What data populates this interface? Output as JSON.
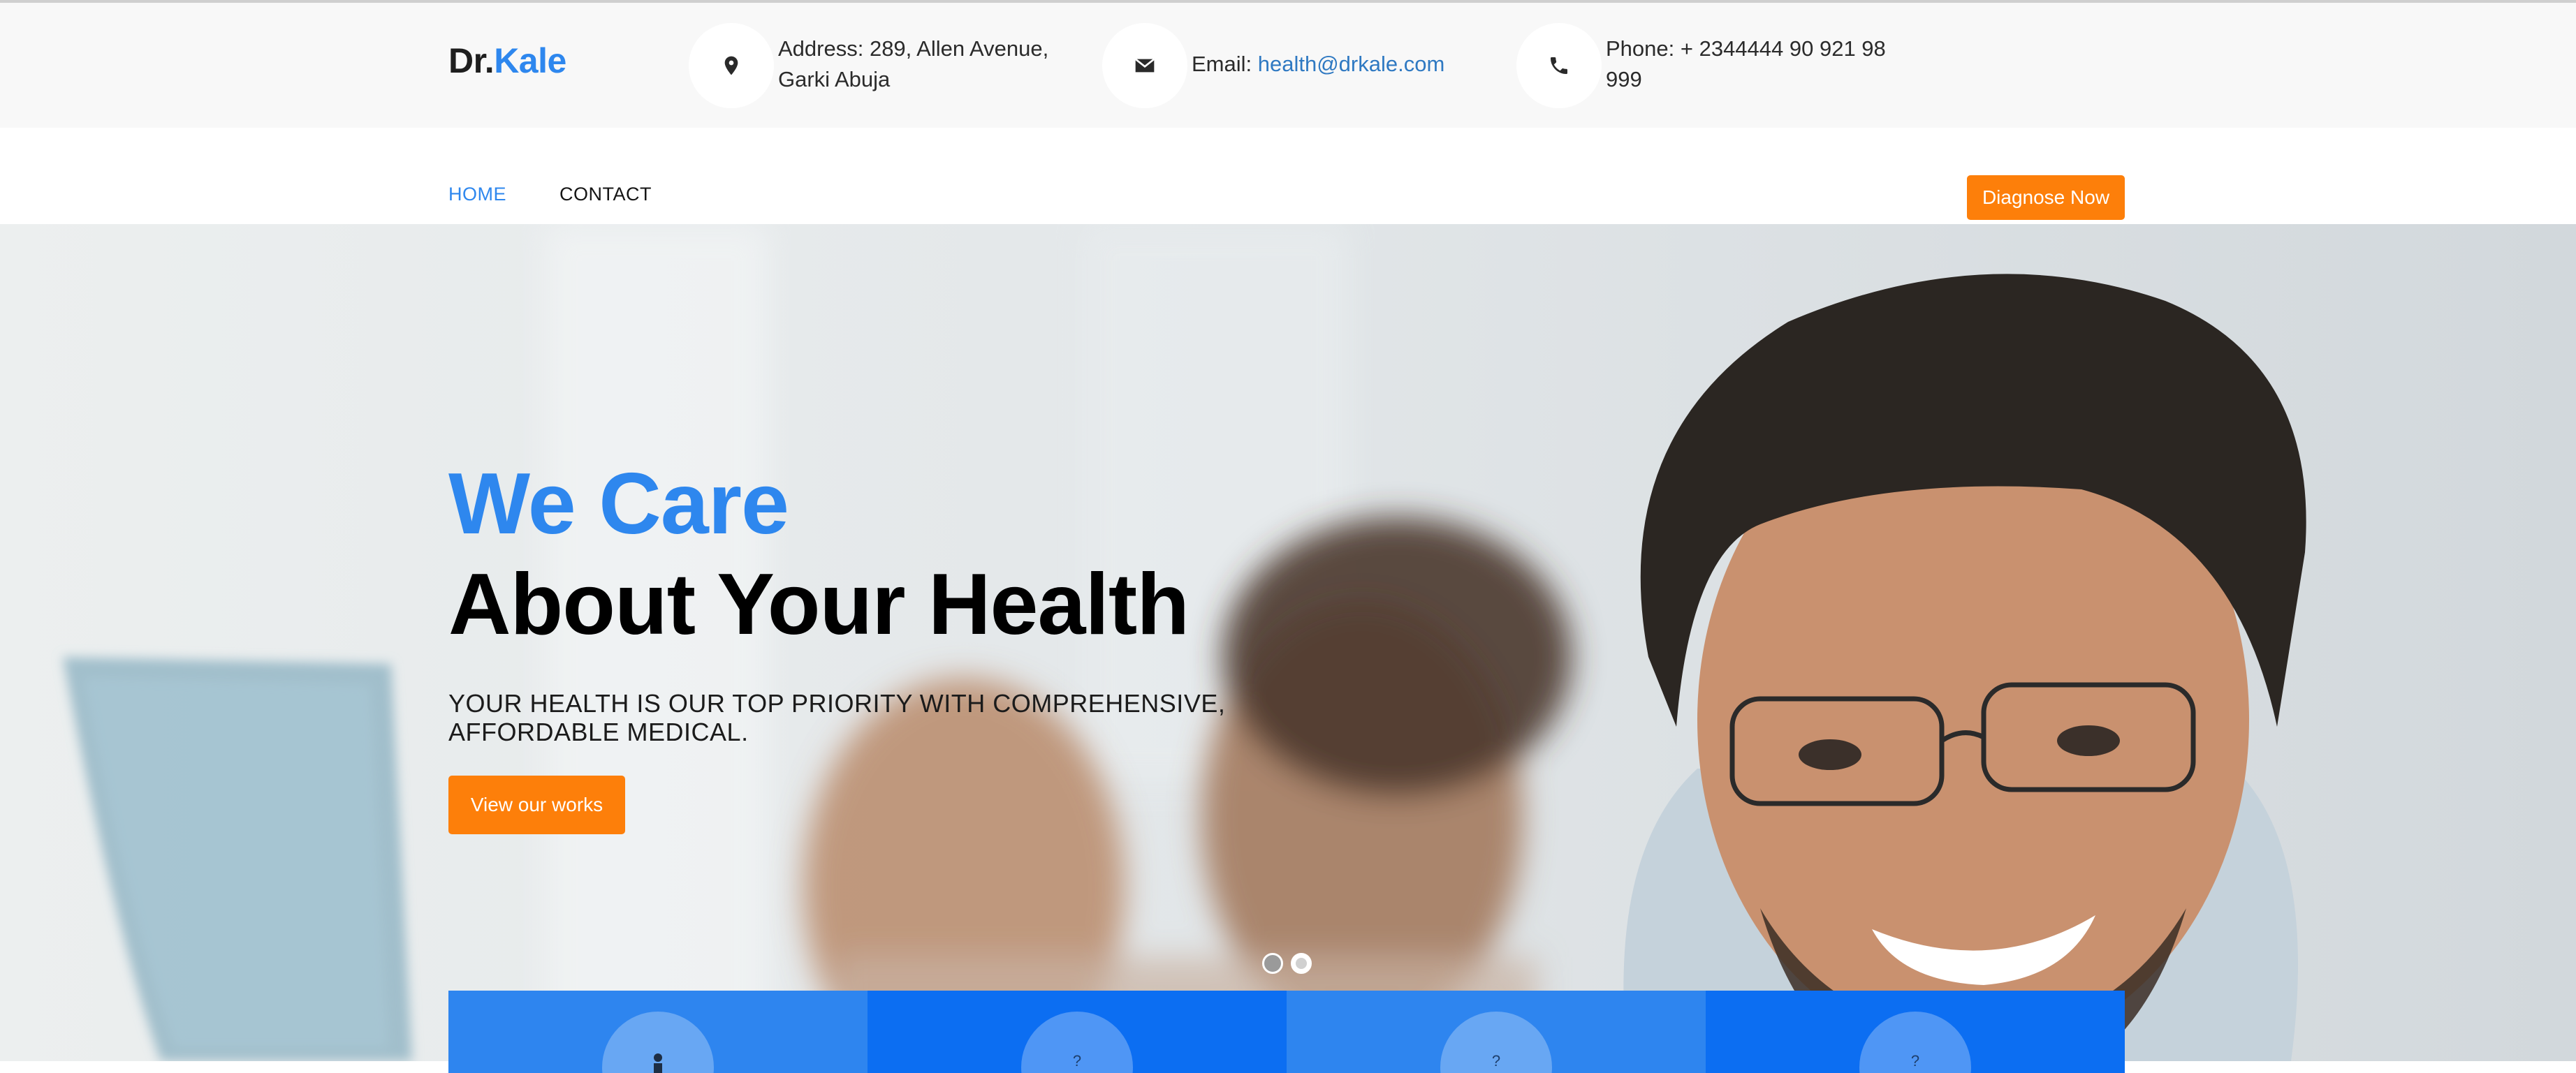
{
  "brand": {
    "prefix": "Dr.",
    "name": "Kale"
  },
  "contact_bar": {
    "address": {
      "icon": "map-pin-icon",
      "line1": "Address: 289, Allen Avenue,",
      "line2": "Garki Abuja"
    },
    "email": {
      "icon": "envelope-icon",
      "label": "Email: ",
      "value": "health@drkale.com"
    },
    "phone": {
      "icon": "phone-icon",
      "line1": "Phone: + 2344444 90 921 98",
      "line2": "999"
    }
  },
  "nav": {
    "items": [
      {
        "label": "HOME",
        "active": true
      },
      {
        "label": "CONTACT",
        "active": false
      }
    ],
    "cta_label": "Diagnose Now"
  },
  "hero": {
    "headline_accent": "We Care",
    "headline_main": "About Your Health",
    "subtitle_line1": "YOUR HEALTH IS OUR TOP PRIORITY WITH COMPREHENSIVE,",
    "subtitle_line2": "AFFORDABLE MEDICAL.",
    "cta_label": "View our works",
    "slides": 2,
    "active_slide": 2
  },
  "features": [
    {
      "icon": "person-icon",
      "glyph": "․"
    },
    {
      "icon": "question-icon",
      "glyph": "?"
    },
    {
      "icon": "question-icon",
      "glyph": "?"
    },
    {
      "icon": "question-icon",
      "glyph": "?"
    }
  ],
  "colors": {
    "brand_blue": "#2e87ee",
    "cta_orange": "#fd7f0a",
    "link_blue": "#2f79c2",
    "strip_blue_light": "#2e85ef",
    "strip_blue_dark": "#0c6ef2"
  }
}
